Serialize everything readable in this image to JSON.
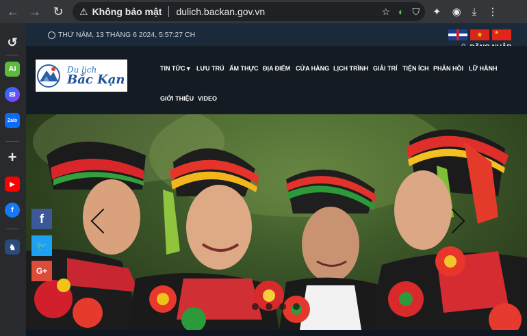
{
  "browser": {
    "security_label": "Không bảo mật",
    "url": "dulich.backan.gov.vn"
  },
  "site": {
    "datetime": "THỨ NĂM, 13 THÁNG 6 2024, 5:57:27 CH",
    "login": "ĐĂNG NHẬP",
    "logo": {
      "line1": "Du lịch",
      "line2": "Bắc Kạn"
    },
    "menu": [
      {
        "label": "TIN TỨC ▾"
      },
      {
        "label": "LƯU TRÚ"
      },
      {
        "label": "ẨM THỰC"
      },
      {
        "label": "ĐỊA ĐIỂM"
      },
      {
        "label": "CỬA HÀNG"
      },
      {
        "label": "LỊCH TRÌNH"
      },
      {
        "label": "GIẢI TRÍ"
      },
      {
        "label": "TIỆN ÍCH"
      },
      {
        "label": "PHẢN HỒI"
      },
      {
        "label": "LỮ HÀNH"
      },
      {
        "label": "GIỚI THIỆU"
      },
      {
        "label": "VIDEO"
      }
    ],
    "social": [
      {
        "label": "f",
        "color": "#3b5998"
      },
      {
        "label": "🐦",
        "color": "#1da1f2"
      },
      {
        "label": "G+",
        "color": "#dd4b39"
      }
    ],
    "flags": [
      "flag-uk",
      "flag-vn",
      "flag-cn"
    ]
  },
  "sidebar": {
    "icons": [
      "history-icon",
      "ai-icon",
      "messenger-icon",
      "zalo-icon",
      "add-icon",
      "youtube-icon",
      "facebook-icon",
      "game-icon"
    ]
  }
}
